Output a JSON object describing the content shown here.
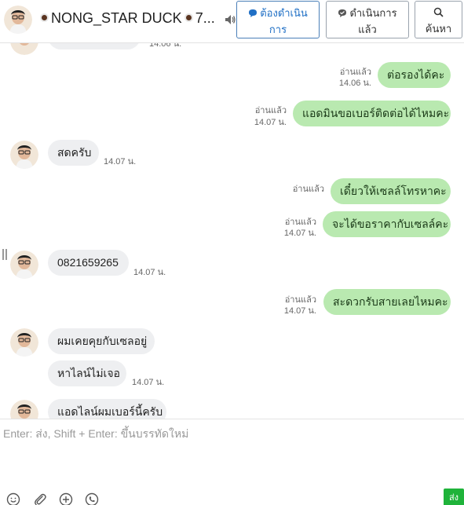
{
  "header": {
    "contact_name": "NONG_STAR DUCK",
    "name_suffix": "7...",
    "pending_button": {
      "line1": "ต้องดำเนิน",
      "line2": "การ"
    },
    "done_button": {
      "line1": "ดำเนินการ",
      "line2": "แล้ว"
    },
    "search_button": "ค้นหา"
  },
  "messages": [
    {
      "direction": "in",
      "text": "",
      "time": "14.06 น.",
      "avatar": true
    },
    {
      "direction": "out",
      "text": "ต่อรองได้คะ",
      "read": "อ่านแล้ว",
      "time": "14.06 น."
    },
    {
      "direction": "out",
      "text": "แอดมินขอเบอร์ติดต่อได้ไหมคะ",
      "read": "อ่านแล้ว",
      "time": "14.07 น."
    },
    {
      "direction": "in",
      "text": "สดครับ",
      "time": "14.07 น.",
      "avatar": true
    },
    {
      "direction": "out",
      "text": "เดี๋ยวให้เซลล์โทรหาคะ",
      "read": "อ่านแล้ว",
      "time": ""
    },
    {
      "direction": "out",
      "text": "จะได้ขอราคากับเซลล์คะ",
      "read": "อ่านแล้ว",
      "time": "14.07 น."
    },
    {
      "direction": "in",
      "text": "0821659265",
      "time": "14.07 น.",
      "avatar": true
    },
    {
      "direction": "out",
      "text": "สะดวกรับสายเลยไหมคะ",
      "read": "อ่านแล้ว",
      "time": "14.07 น."
    },
    {
      "direction": "in",
      "text": "ผมเคยคุยกับเซลอยู่",
      "time": "",
      "avatar": true
    },
    {
      "direction": "in",
      "text": "หาไลน์ไม่เจอ",
      "time": "14.07 น.",
      "avatar": false
    },
    {
      "direction": "in",
      "text": "แอดไลน์ผมเบอร์นี้ครับ",
      "time": "",
      "avatar": true
    }
  ],
  "composer": {
    "placeholder": "Enter: ส่ง, Shift + Enter: ขึ้นบรรทัดใหม่",
    "send_label": "ส่ง"
  },
  "colors": {
    "outgoing_bubble": "#b9e9b0",
    "incoming_bubble": "#eeeff1",
    "send_button": "#1fb33a",
    "pending_accent": "#1f6fc5"
  },
  "icons": [
    "speaker-icon",
    "comment-alert-icon",
    "comment-check-icon",
    "search-icon",
    "emoji-icon",
    "attachment-icon",
    "add-icon",
    "phone-icon"
  ]
}
